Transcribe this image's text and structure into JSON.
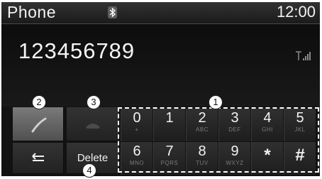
{
  "header": {
    "title": "Phone",
    "clock": "12:00",
    "icons": {
      "bluetooth": "bluetooth-icon",
      "signal": "signal-strength-icon"
    }
  },
  "dial": {
    "number": "123456789"
  },
  "controls": {
    "call_icon": "handset-call-icon",
    "end_icon": "handset-end-icon",
    "back_icon": "back-arrow-icon",
    "delete_label": "Delete"
  },
  "keypad": {
    "row1": [
      {
        "digit": "0",
        "sub": "+"
      },
      {
        "digit": "1",
        "sub": ""
      },
      {
        "digit": "2",
        "sub": "ABC"
      },
      {
        "digit": "3",
        "sub": "DEF"
      },
      {
        "digit": "4",
        "sub": "GHI"
      },
      {
        "digit": "5",
        "sub": "JKL"
      }
    ],
    "row2": [
      {
        "digit": "6",
        "sub": "MNO"
      },
      {
        "digit": "7",
        "sub": "PQRS"
      },
      {
        "digit": "8",
        "sub": "TUV"
      },
      {
        "digit": "9",
        "sub": "WXYZ"
      },
      {
        "digit": "*",
        "sub": ""
      },
      {
        "digit": "#",
        "sub": ""
      }
    ]
  },
  "callouts": {
    "c1": "1",
    "c2": "2",
    "c3": "3",
    "c4": "4"
  },
  "colors": {
    "screen_bg": "#121212",
    "text": "#f2f2f2",
    "subtext": "#7a7a7a"
  }
}
